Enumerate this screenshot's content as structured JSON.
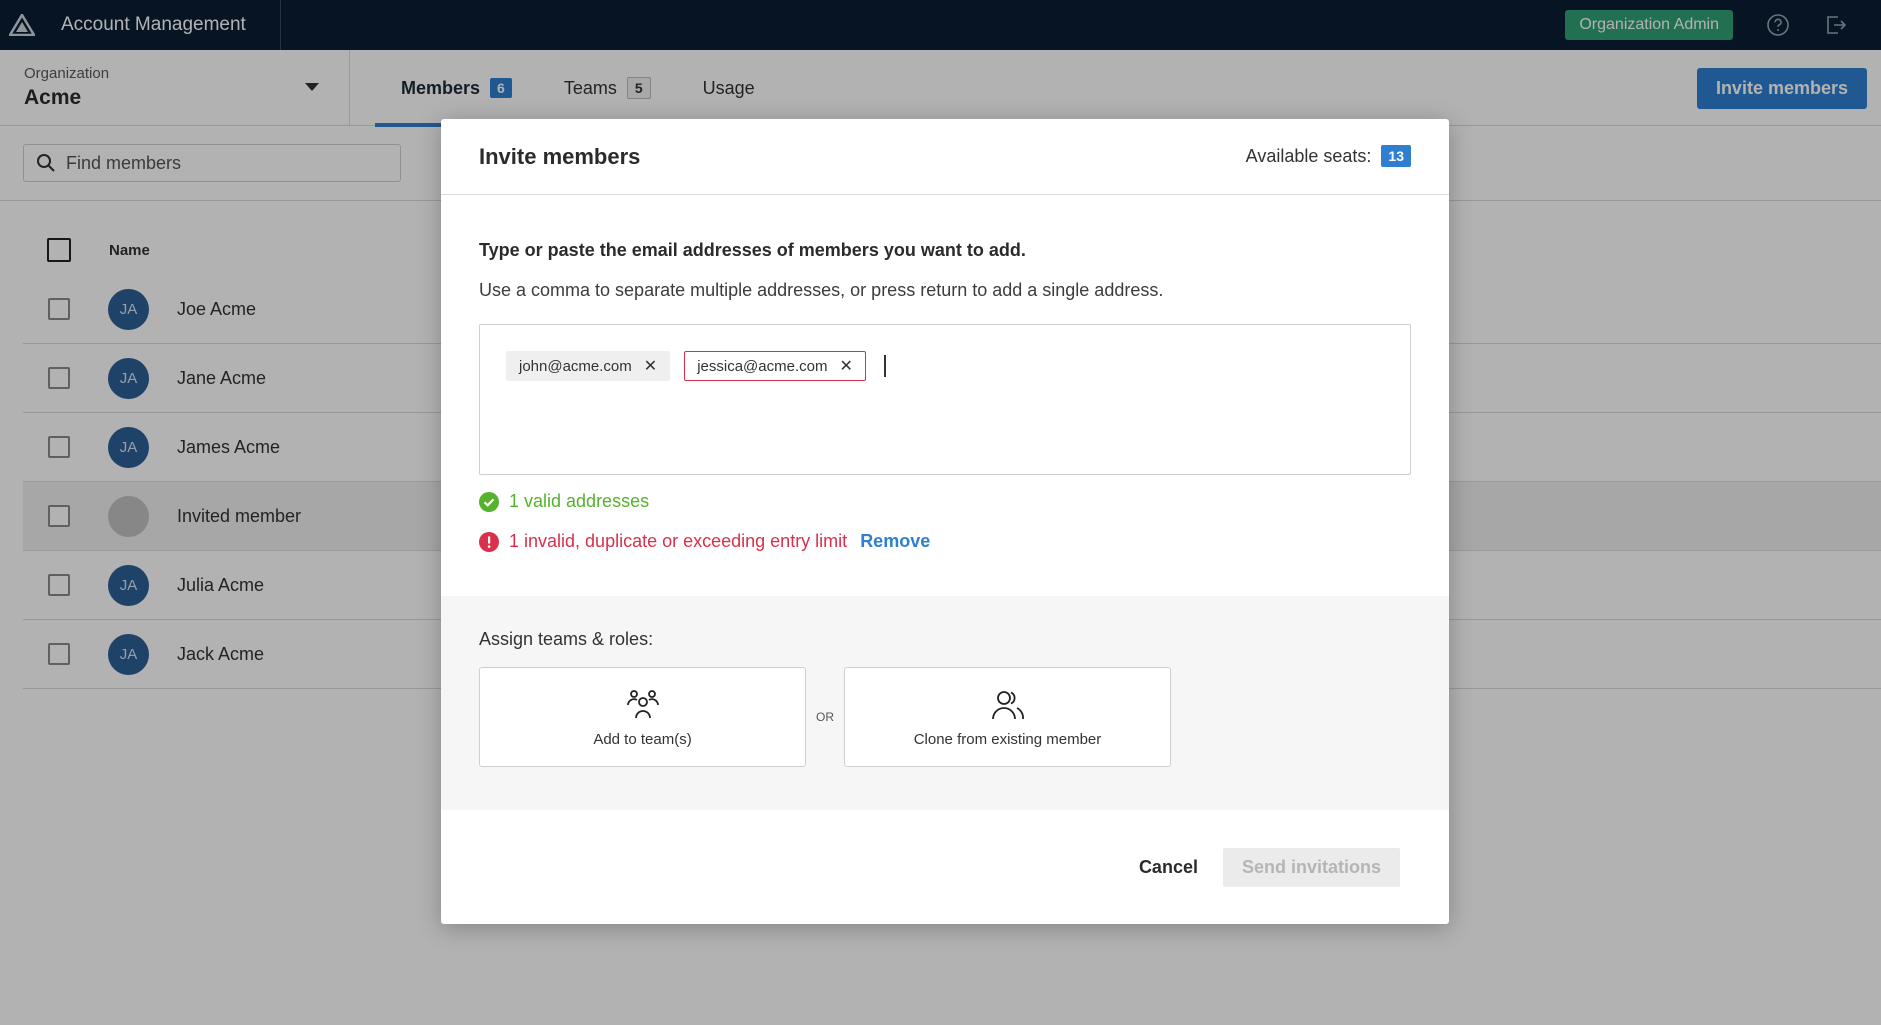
{
  "app": {
    "title": "Account Management",
    "role": "Organization Admin"
  },
  "org": {
    "label": "Organization",
    "value": "Acme"
  },
  "tabs": [
    {
      "label": "Members",
      "count": "6"
    },
    {
      "label": "Teams",
      "count": "5"
    },
    {
      "label": "Usage"
    }
  ],
  "toolbar": {
    "invite_label": "Invite members"
  },
  "search": {
    "placeholder": "Find members"
  },
  "table": {
    "name_header": "Name",
    "rows": [
      {
        "initials": "JA",
        "name": "Joe Acme"
      },
      {
        "initials": "JA",
        "name": "Jane Acme"
      },
      {
        "initials": "JA",
        "name": "James Acme"
      },
      {
        "initials": "",
        "name": "Invited member"
      },
      {
        "initials": "JA",
        "name": "Julia Acme"
      },
      {
        "initials": "JA",
        "name": "Jack Acme"
      }
    ]
  },
  "modal": {
    "title": "Invite members",
    "seats_label": "Available seats:",
    "seats_count": "13",
    "instruction_bold": "Type or paste the email addresses of members you want to add.",
    "instruction": "Use a comma to separate multiple addresses, or press return to add a single address.",
    "emails": [
      {
        "address": "john@acme.com",
        "valid": true
      },
      {
        "address": "jessica@acme.com",
        "valid": false
      }
    ],
    "valid_text": "1 valid addresses",
    "invalid_text": "1 invalid, duplicate or exceeding entry limit",
    "remove_label": "Remove",
    "assign_label": "Assign teams & roles:",
    "option_teams": "Add to team(s)",
    "or_label": "OR",
    "option_clone": "Clone from existing member",
    "cancel_label": "Cancel",
    "send_label": "Send invitations"
  },
  "colors": {
    "topbar": "#0b1e33",
    "accent": "#2f7fd0",
    "role_badge": "#2fa174",
    "valid": "#56b12c",
    "invalid": "#d9304c"
  }
}
